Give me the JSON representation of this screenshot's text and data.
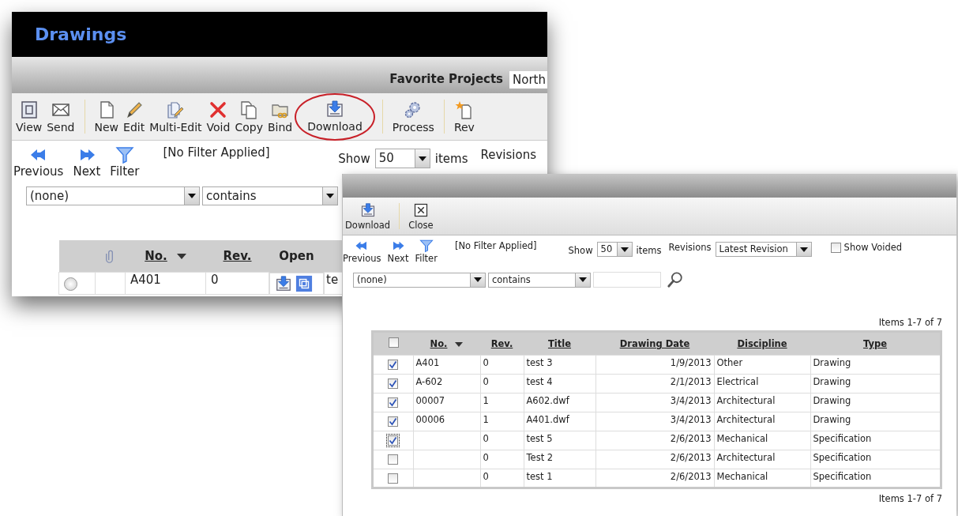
{
  "back_window": {
    "title": "Drawings",
    "favorite_projects": {
      "label": "Favorite Projects",
      "value": "North"
    },
    "toolbar": [
      [
        {
          "kind": "view",
          "label": "View",
          "highlighted": false
        },
        {
          "kind": "send",
          "label": "Send",
          "highlighted": false
        }
      ],
      [
        {
          "kind": "new",
          "label": "New",
          "highlighted": false
        },
        {
          "kind": "edit",
          "label": "Edit",
          "highlighted": false
        },
        {
          "kind": "multi_edit",
          "label": "Multi-Edit",
          "highlighted": false
        },
        {
          "kind": "void",
          "label": "Void",
          "highlighted": false
        },
        {
          "kind": "copy",
          "label": "Copy",
          "highlighted": false
        },
        {
          "kind": "bind",
          "label": "Bind",
          "highlighted": false
        },
        {
          "kind": "download",
          "label": "Download",
          "highlighted": true
        }
      ],
      [
        {
          "kind": "process",
          "label": "Process",
          "highlighted": false
        }
      ],
      [
        {
          "kind": "revise",
          "label": "Rev",
          "highlighted": false
        }
      ]
    ],
    "nav": {
      "previous": "Previous",
      "next": "Next",
      "filter": "Filter",
      "filter_status": "[No Filter Applied]",
      "show": "Show",
      "page_size": "50",
      "items": "items",
      "revisions": "Revisions"
    },
    "filter": {
      "field": "(none)",
      "operator": "contains"
    },
    "table": {
      "columns": [
        {
          "label": "No.",
          "sorted": true
        },
        {
          "label": "Rev.",
          "sorted": false
        },
        {
          "label": "Open",
          "sorted": false
        }
      ],
      "rows": [
        {
          "selected": false,
          "no": "A401",
          "rev": "0",
          "column_5": "te"
        }
      ]
    }
  },
  "front_window": {
    "toolbar": [
      {
        "kind": "download",
        "label": "Download"
      },
      {
        "kind": "close",
        "label": "Close"
      }
    ],
    "nav": {
      "previous": "Previous",
      "next": "Next",
      "filter": "Filter",
      "filter_status": "[No Filter Applied]",
      "show": "Show",
      "page_size": "50",
      "items": "items",
      "revisions": "Revisions",
      "revisions_value": "Latest Revision",
      "show_voided": {
        "label": "Show Voided",
        "checked": false
      }
    },
    "filter": {
      "field": "(none)",
      "operator": "contains"
    },
    "items_count_top": "Items 1-7 of 7",
    "table": {
      "all_checked": false,
      "columns": [
        {
          "label": "No.",
          "sorted": true
        },
        {
          "label": "Rev.",
          "sorted": false
        },
        {
          "label": "Title",
          "sorted": false
        },
        {
          "label": "Drawing Date",
          "sorted": false
        },
        {
          "label": "Discipline",
          "sorted": false
        },
        {
          "label": "Type",
          "sorted": false
        }
      ],
      "rows": [
        {
          "checked": true,
          "focused": false,
          "no": "A401",
          "rev": "0",
          "title": "test 3",
          "drawing_date": "1/9/2013",
          "discipline": "Other",
          "type": "Drawing"
        },
        {
          "checked": true,
          "focused": false,
          "no": "A-602",
          "rev": "0",
          "title": "test 4",
          "drawing_date": "2/1/2013",
          "discipline": "Electrical",
          "type": "Drawing"
        },
        {
          "checked": true,
          "focused": false,
          "no": "00007",
          "rev": "1",
          "title": "A602.dwf",
          "drawing_date": "3/4/2013",
          "discipline": "Architectural",
          "type": "Drawing"
        },
        {
          "checked": true,
          "focused": false,
          "no": "00006",
          "rev": "1",
          "title": "A401.dwf",
          "drawing_date": "3/4/2013",
          "discipline": "Architectural",
          "type": "Drawing"
        },
        {
          "checked": true,
          "focused": true,
          "rev": "0",
          "title": "test 5",
          "drawing_date": "2/6/2013",
          "discipline": "Mechanical",
          "type": "Specification"
        },
        {
          "checked": false,
          "focused": false,
          "rev": "0",
          "title": "Test 2",
          "drawing_date": "2/6/2013",
          "discipline": "Architectural",
          "type": "Specification"
        },
        {
          "checked": false,
          "focused": false,
          "rev": "0",
          "title": "test 1",
          "drawing_date": "2/6/2013",
          "discipline": "Mechanical",
          "type": "Specification"
        }
      ]
    },
    "items_count_bottom": "Items 1-7 of 7"
  }
}
